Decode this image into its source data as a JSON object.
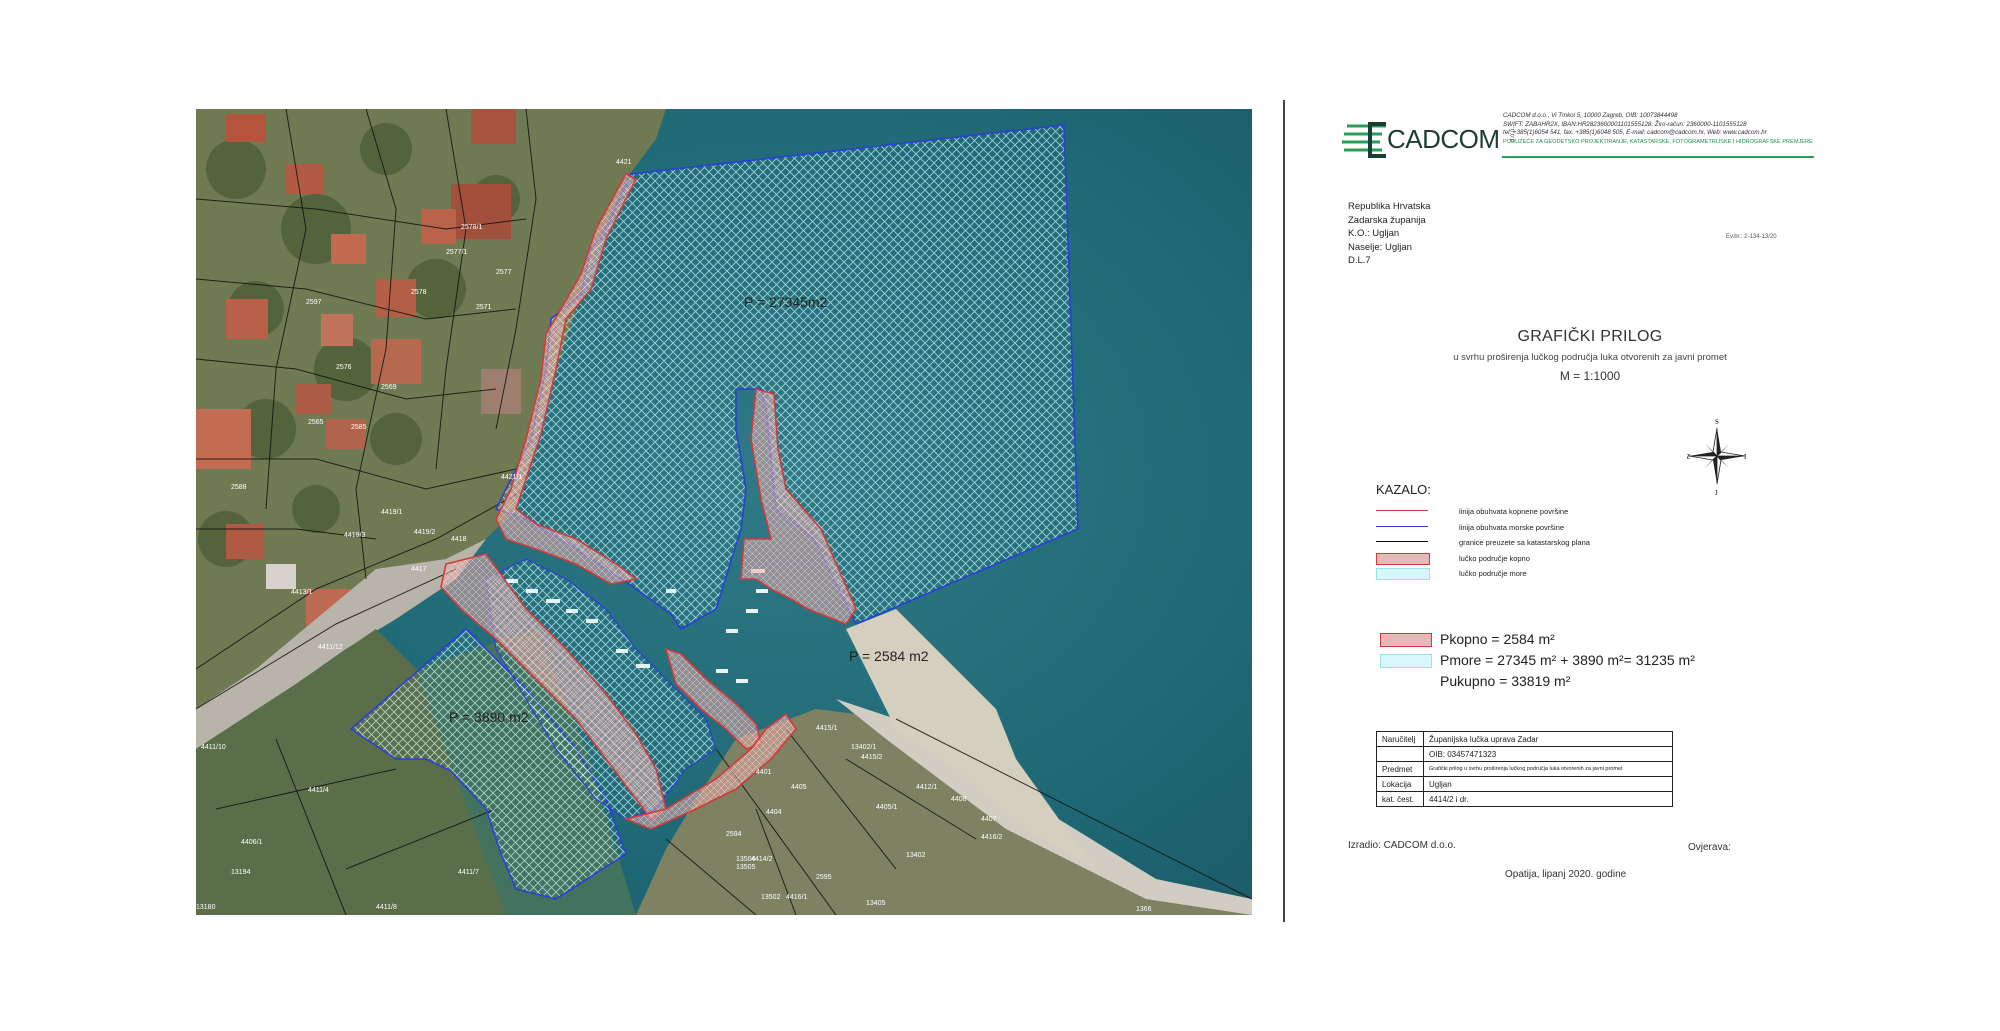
{
  "map": {
    "labels": {
      "sea_main_area": "P = 27345m2",
      "sea_small_area": "P = 3890 m2",
      "land_area": "P = 2584 m2"
    },
    "parcel_numbers": [
      "4421",
      "4421/1",
      "4419/1",
      "4419/3",
      "4419/2",
      "4418",
      "4417",
      "4413/1",
      "4411/12",
      "4411/10",
      "4411/4",
      "4411/7",
      "4411/8",
      "4415/1",
      "4415/2",
      "4406/1",
      "4412/1",
      "4416/2",
      "4416/1",
      "4414/2",
      "4404",
      "4405",
      "4401",
      "2594",
      "2595",
      "2597",
      "2588",
      "2585",
      "2578",
      "2576",
      "2578/1",
      "2577/1",
      "2577",
      "2571",
      "2565",
      "2569",
      "13504",
      "13194",
      "13405",
      "13402",
      "13402/1",
      "13505",
      "13502",
      "13180",
      "1366",
      "4408",
      "4407",
      "4405/1"
    ],
    "colors": {
      "sea_outline": "#2b3fd6",
      "land_outline": "#d23a3a",
      "land_fill": "#e9a7a7",
      "sea_hatch": "#c8f2f5",
      "cadastral": "#111111"
    }
  },
  "sheet": {
    "logo": {
      "text": "CADCOM",
      "tag": "d.o.o."
    },
    "company_info": [
      "CADCOM d.o.o., Vi Trnkoi 5, 10000 Zagreb, OIB: 10073844498",
      "SWIFT: ZABAHR2X, IBAN:HR2823600001101555128, Žiro-račun: 2360000-1101555128",
      "tel. +385(1)6054 541, fax. +385(1)6048 505, E-mail: cadcom@cadcom.hr, Web: www.cadcom.hr"
    ],
    "company_subtitle": "PODUZEĆE ZA GEODETSKO PROJEKTIRANJE, KATASTARSKE, FOTOGRAMETRIJSKE I HIDROGRAFSKE PREMJERE",
    "address_lines": [
      "Republika Hrvatska",
      "Zadarska županija",
      "K.O.: Ugljan",
      "Naselje: Ugljan",
      "D.L.7"
    ],
    "evidence_no": "Ev.br.: 2-134-13/20",
    "title": "GRAFIČKI PRILOG",
    "subtitle": "u svrhu proširenja lučkog područja luka otvorenih za javni promet",
    "scale": "M = 1:1000",
    "compass": {
      "n": "S",
      "s": "J",
      "e": "I",
      "w": "Z"
    },
    "legend_title": "KAZALO:",
    "legend": [
      {
        "label": "linija obuhvata kopnene površine",
        "kind": "line",
        "color": "#d23a3a"
      },
      {
        "label": "linija obuhvata morske površine",
        "kind": "line",
        "color": "#2b3fd6"
      },
      {
        "label": "granice preuzete sa katastarskog plana",
        "kind": "line",
        "color": "#111111"
      },
      {
        "label": "lučko područje kopno",
        "kind": "box",
        "color": "#e8b7b7"
      },
      {
        "label": "lučko područje more",
        "kind": "box",
        "color": "#d8f7fb"
      }
    ],
    "areas": [
      {
        "text": "Pkopno = 2584 m²",
        "color": "#e8b7b7"
      },
      {
        "text": "Pmore = 27345 m² + 3890 m²= 31235 m²",
        "color": "#d8f7fb"
      },
      {
        "text": "Pukupno = 33819 m²",
        "color": ""
      }
    ],
    "info_table": [
      {
        "key": "Naručitelj",
        "value": "Županijska lučka uprava Zadar"
      },
      {
        "key": "",
        "value": "OIB: 03457471323"
      },
      {
        "key": "Predmet",
        "value": "Grafički prilog u svrhu proširenja lučkog područja luka otvorenih za javni promet"
      },
      {
        "key": "Lokacija",
        "value": "Ugljan"
      },
      {
        "key": "kat. čest.",
        "value": "4414/2 i dr."
      }
    ],
    "made_by": "Izradio: CADCOM d.o.o.",
    "verified": "Ovjerava:",
    "place_date": "Opatija, lipanj 2020. godine"
  }
}
